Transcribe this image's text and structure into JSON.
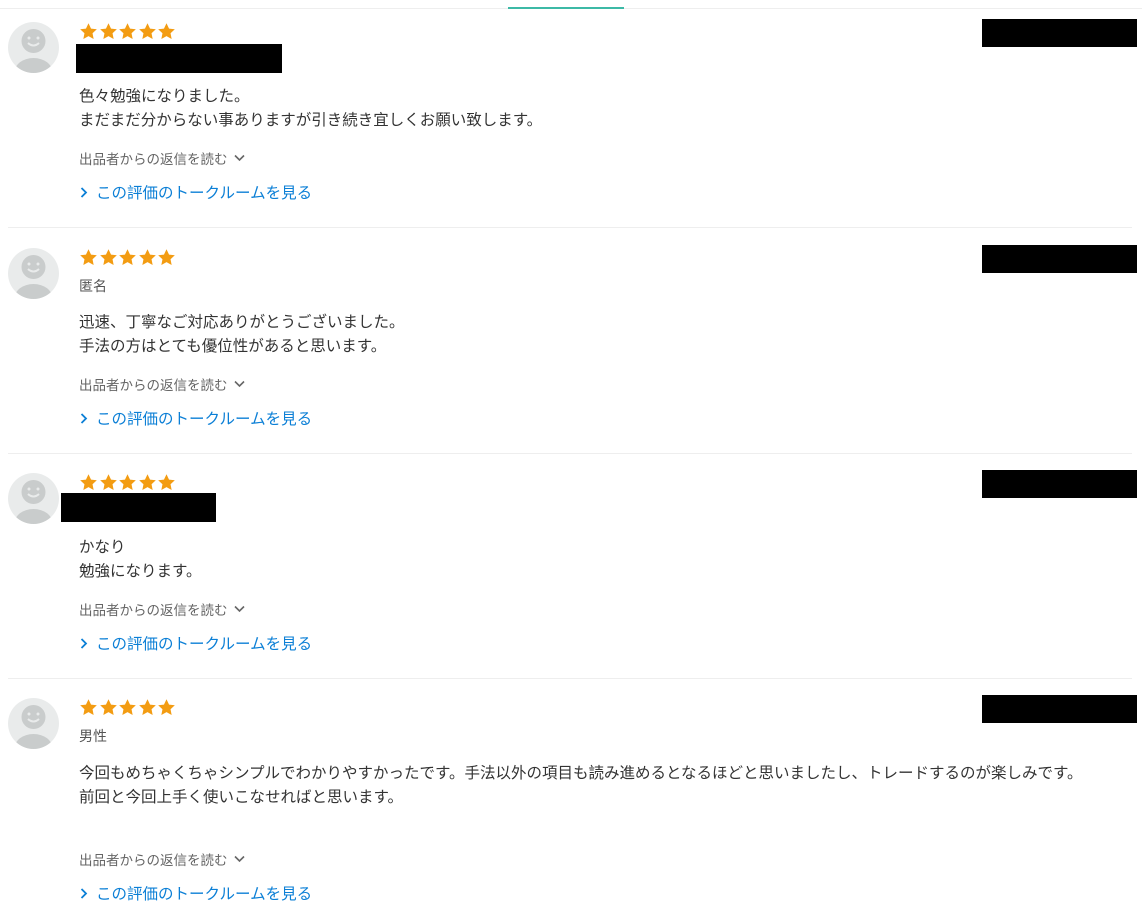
{
  "reviews": [
    {
      "rating": 5,
      "username": "",
      "username_redacted": true,
      "comment_lines": [
        "色々勉強になりました。",
        "まだまだ分からない事ありますが引き続き宜しくお願い致します。"
      ],
      "reply_toggle_label": "出品者からの返信を読む",
      "talk_room_link": "この評価のトークルームを見る"
    },
    {
      "rating": 5,
      "username": "匿名",
      "username_redacted": false,
      "comment_lines": [
        "迅速、丁寧なご対応ありがとうございました。",
        "手法の方はとても優位性があると思います。"
      ],
      "reply_toggle_label": "出品者からの返信を読む",
      "talk_room_link": "この評価のトークルームを見る"
    },
    {
      "rating": 5,
      "username": "",
      "username_redacted": true,
      "comment_lines": [
        "かなり",
        "勉強になります。"
      ],
      "reply_toggle_label": "出品者からの返信を読む",
      "talk_room_link": "この評価のトークルームを見る"
    },
    {
      "rating": 5,
      "username": "男性",
      "username_redacted": false,
      "comment_lines": [
        "今回もめちゃくちゃシンプルでわかりやすかったです。手法以外の項目も読み進めるとなるほどと思いましたし、トレードするのが楽しみです。",
        "前回と今回上手く使いこなせればと思います。"
      ],
      "reply_toggle_label": "出品者からの返信を読む",
      "talk_room_link": "この評価のトークルームを見る"
    }
  ],
  "colors": {
    "star": "#f39c12",
    "link": "#0b7fd6",
    "accent": "#3cb9a6",
    "redaction": "#000000"
  },
  "icons": {
    "avatar": "default-user-avatar-icon",
    "star": "star-icon",
    "reply_chevron": "chevron-down-icon",
    "link_chevron": "chevron-right-icon"
  }
}
